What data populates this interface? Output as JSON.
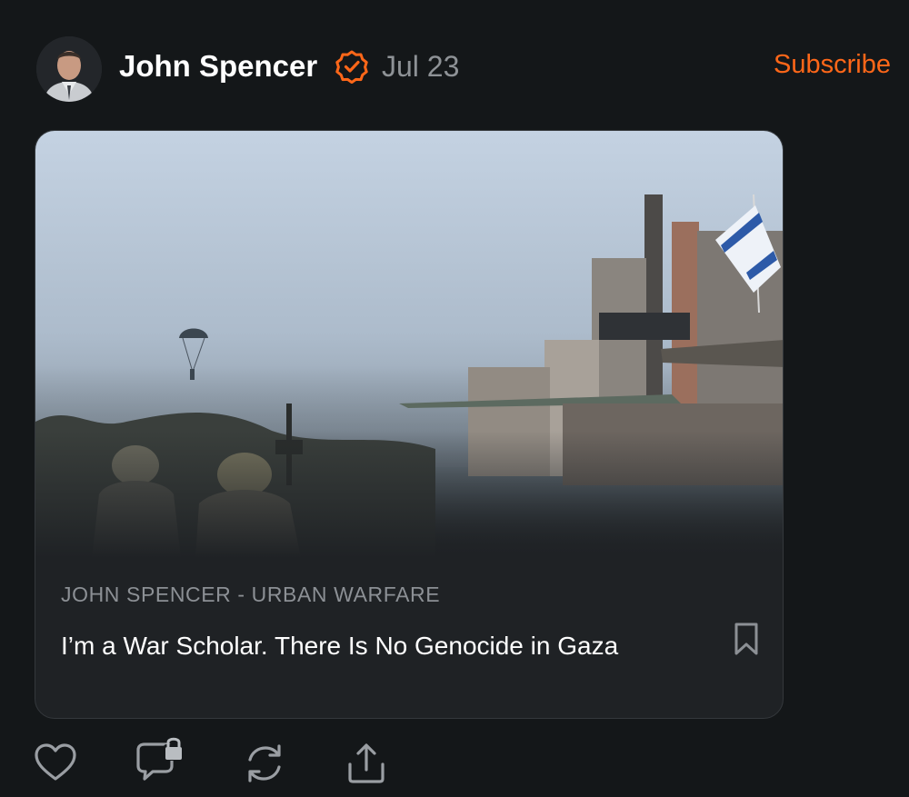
{
  "author": {
    "name": "John Spencer",
    "verified_icon": "verified-badge-icon",
    "date": "Jul 23",
    "avatar_icon": "avatar"
  },
  "header": {
    "subscribe_label": "Subscribe"
  },
  "card": {
    "publication": "JOHN SPENCER - URBAN WARFARE",
    "title": "I’m a War Scholar. There Is No Genocide in Gaza",
    "image_icon": "article-image"
  },
  "actions": [
    {
      "icon": "heart-icon"
    },
    {
      "icon": "comment-locked-icon"
    },
    {
      "icon": "restack-icon"
    },
    {
      "icon": "share-icon"
    }
  ],
  "colors": {
    "background": "#141719",
    "accent": "#ff6719",
    "muted_text": "#8e9296",
    "card": "#1f2225"
  }
}
